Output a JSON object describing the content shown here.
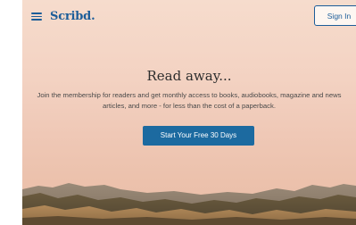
{
  "header": {
    "logo_text": "Scribd.",
    "signin_label": "Sign In"
  },
  "hero": {
    "title": "Read away...",
    "description": "Join the membership for readers and get monthly access to books, audiobooks, magazine and news articles, and more - for less than the cost of a paperback.",
    "cta_label": "Start Your Free 30 Days"
  },
  "colors": {
    "brand_blue": "#1c5d99",
    "cta_blue": "#1c6aa0",
    "background_peach": "#f3d2c2"
  },
  "icons": {
    "menu": "hamburger-menu-icon"
  }
}
